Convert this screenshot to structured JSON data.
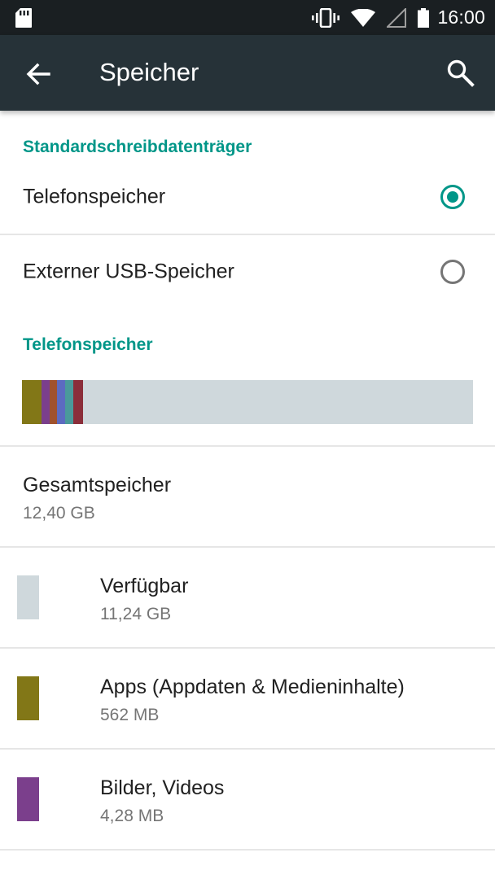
{
  "status_bar": {
    "time": "16:00",
    "icons": [
      "sd-card-icon",
      "vibrate-icon",
      "wifi-icon",
      "signal-icon",
      "battery-icon"
    ]
  },
  "app_bar": {
    "title": "Speicher",
    "back_icon": "arrow-back-icon",
    "search_icon": "search-icon",
    "background": "#263238"
  },
  "default_storage": {
    "header": "Standardschreibdatenträger",
    "options": [
      {
        "label": "Telefonspeicher",
        "selected": true
      },
      {
        "label": "Externer USB-Speicher",
        "selected": false
      }
    ]
  },
  "phone_storage": {
    "header": "Telefonspeicher",
    "usage_segments_percent": [
      {
        "color": "#827717",
        "percent": 4.4
      },
      {
        "color": "#7b3f8c",
        "percent": 1.8
      },
      {
        "color": "#a0522d",
        "percent": 1.6
      },
      {
        "color": "#5c6bc0",
        "percent": 1.8
      },
      {
        "color": "#4a9a9a",
        "percent": 1.8
      },
      {
        "color": "#8b2e3a",
        "percent": 2.2
      }
    ],
    "free_color": "#cfd8dc",
    "total": {
      "title": "Gesamtspeicher",
      "value": "12,40 GB"
    },
    "categories": [
      {
        "title": "Verfügbar",
        "value": "11,24 GB",
        "color": "#cfd8dc"
      },
      {
        "title": "Apps (Appdaten & Medieninhalte)",
        "value": "562 MB",
        "color": "#827717"
      },
      {
        "title": "Bilder, Videos",
        "value": "4,28 MB",
        "color": "#7b3f8c"
      }
    ]
  },
  "accent_color": "#009688"
}
